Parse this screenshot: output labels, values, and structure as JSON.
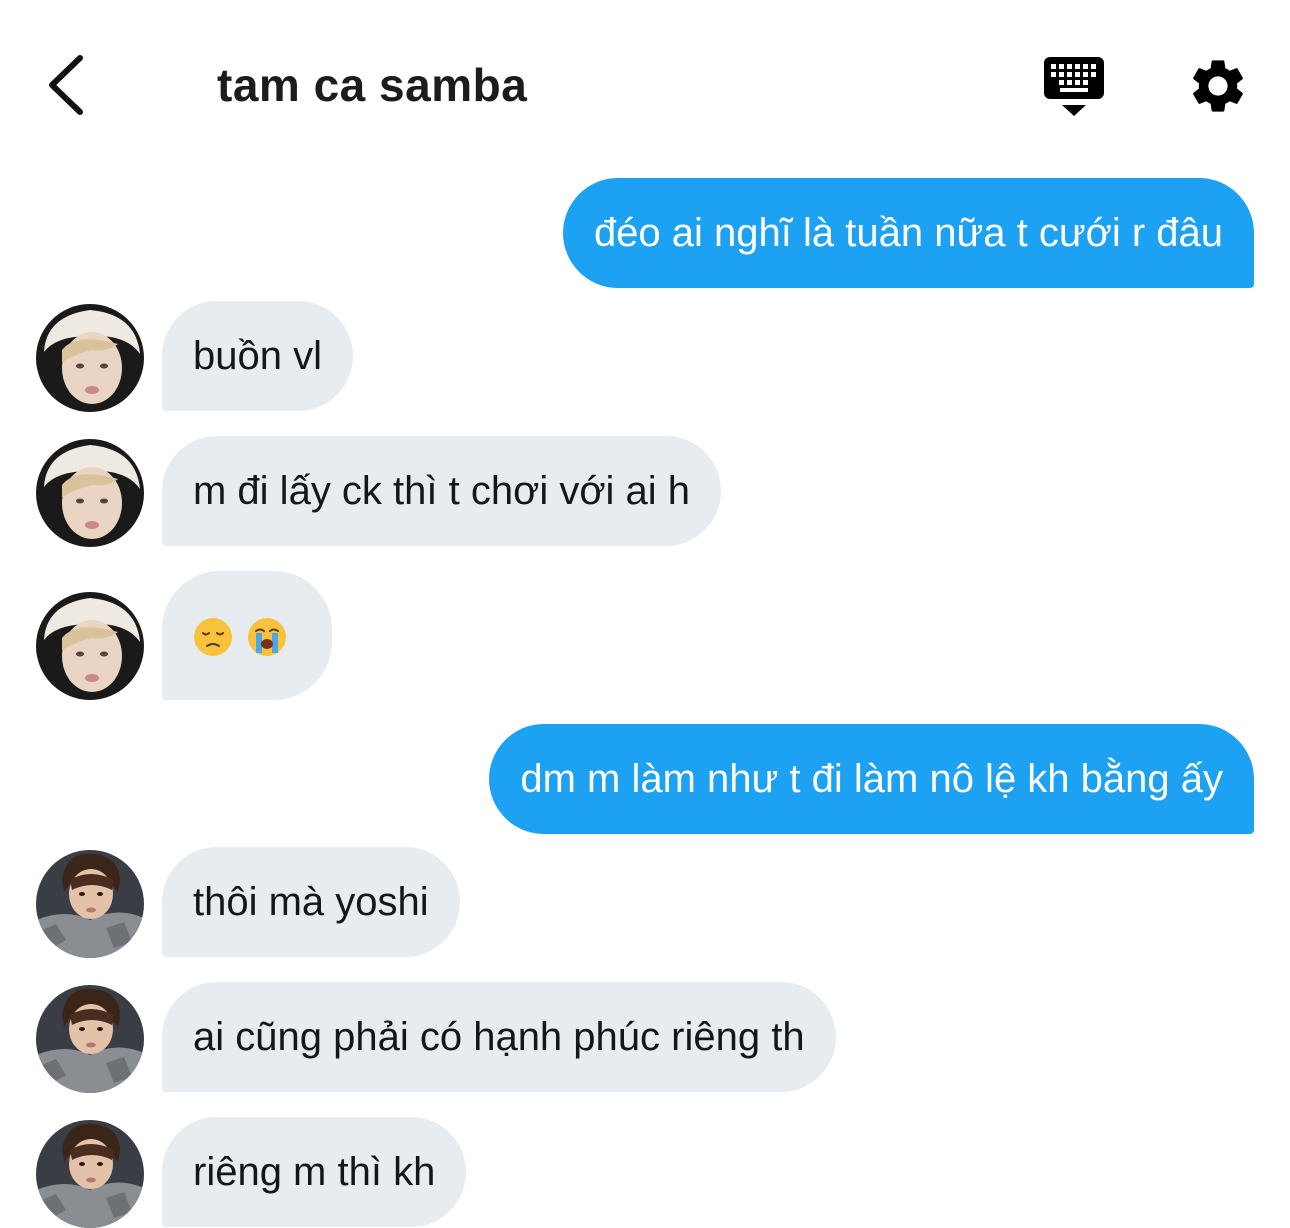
{
  "header": {
    "title": "tam ca samba",
    "back_icon": "chevron-left-icon",
    "keyboard_icon": "keyboard-icon",
    "settings_icon": "gear-icon"
  },
  "colors": {
    "outgoing_bubble": "#1da1f2",
    "incoming_bubble": "#e6ecf0",
    "text": "#14171a"
  },
  "messages": [
    {
      "direction": "out",
      "text": "đéo ai nghĩ là tuần nữa t cưới r đâu"
    },
    {
      "direction": "in",
      "sender": "avatar-1",
      "text": "buồn vl"
    },
    {
      "direction": "in",
      "sender": "avatar-1",
      "text": "m đi lấy ck thì t chơi với ai h"
    },
    {
      "direction": "in",
      "sender": "avatar-1",
      "emojis": [
        "disappointed-face-emoji",
        "loudly-crying-face-emoji"
      ]
    },
    {
      "direction": "out",
      "text": "dm m làm như t đi làm nô lệ kh bằng ấy"
    },
    {
      "direction": "in",
      "sender": "avatar-2",
      "text": "thôi mà yoshi"
    },
    {
      "direction": "in",
      "sender": "avatar-2",
      "text": "ai cũng phải có hạnh phúc riêng th"
    },
    {
      "direction": "in",
      "sender": "avatar-2",
      "text": "riêng m thì kh"
    }
  ]
}
